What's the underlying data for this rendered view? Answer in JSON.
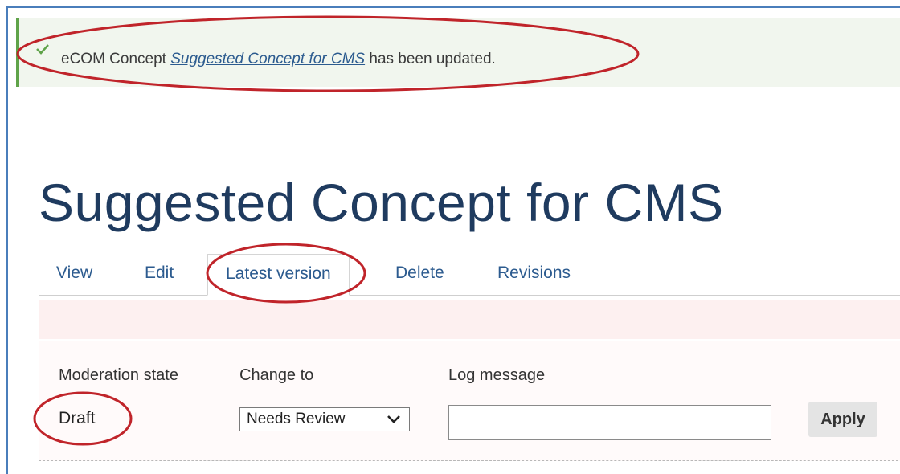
{
  "message": {
    "prefix": "eCOM Concept ",
    "link_text": "Suggested Concept for CMS",
    "suffix": " has been updated.",
    "icon": "check-icon"
  },
  "page": {
    "title": "Suggested Concept for CMS"
  },
  "tabs": [
    {
      "label": "View"
    },
    {
      "label": "Edit"
    },
    {
      "label": "Latest version",
      "active": true
    },
    {
      "label": "Delete"
    },
    {
      "label": "Revisions"
    }
  ],
  "moderation": {
    "state_label": "Moderation state",
    "state_value": "Draft",
    "change_to_label": "Change to",
    "change_to_value": "Needs Review",
    "log_label": "Log message",
    "log_value": "",
    "apply_label": "Apply"
  },
  "colors": {
    "annotation": "#c0242a",
    "link": "#2c5b8f",
    "title": "#1f3b5f",
    "status_success": "#5fa349"
  }
}
